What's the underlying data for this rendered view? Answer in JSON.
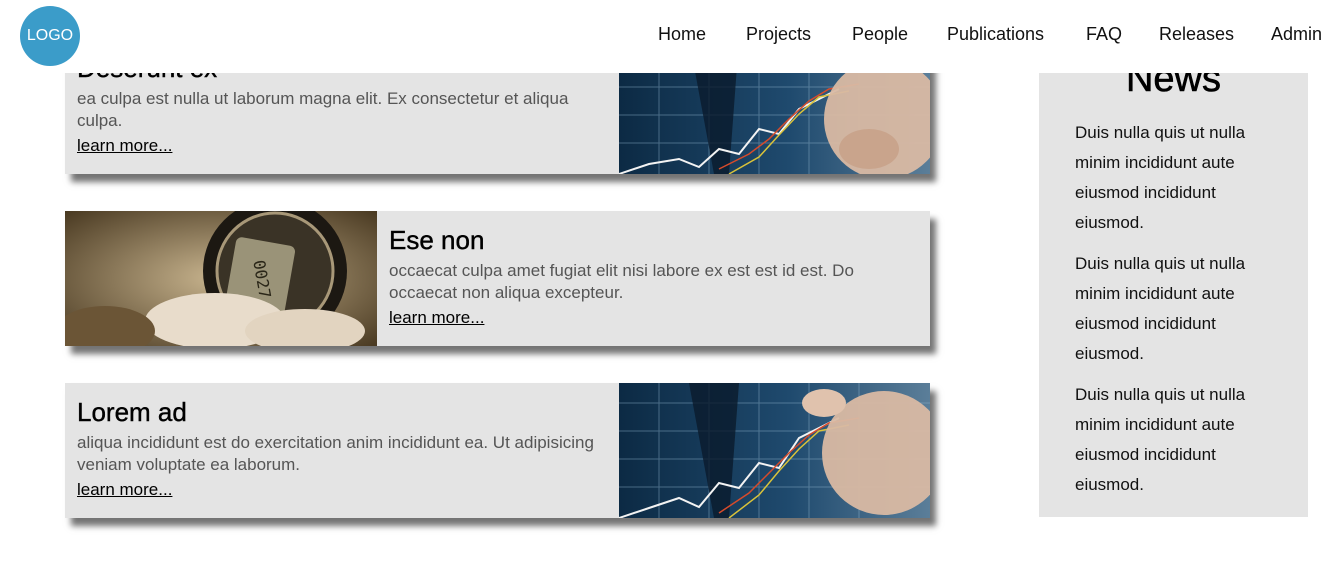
{
  "header": {
    "logo_text": "LOGO",
    "nav": [
      "Home",
      "Projects",
      "People",
      "Publications",
      "FAQ",
      "Releases",
      "Admin"
    ]
  },
  "cards": [
    {
      "title": "Deserunt ex",
      "text": "ea culpa est nulla ut laborum magna elit. Ex consectetur et aliqua culpa.",
      "link": "learn more..."
    },
    {
      "title": "Ese non",
      "text": "occaecat culpa amet fugiat elit nisi labore ex est est id est. Do occaecat non aliqua excepteur.",
      "link": "learn more..."
    },
    {
      "title": "Lorem ad",
      "text": "aliqua incididunt est do exercitation anim incididunt ea. Ut adipisicing veniam voluptate ea laborum.",
      "link": "learn more..."
    }
  ],
  "news": {
    "title": "News",
    "items": [
      "Duis nulla quis ut nulla minim incididunt aute eiusmod incididunt eiusmod.",
      "Duis nulla quis ut nulla minim incididunt aute eiusmod incididunt eiusmod.",
      "Duis nulla quis ut nulla minim incididunt aute eiusmod incididunt eiusmod."
    ]
  },
  "colors": {
    "logo": "#3b9cc9",
    "card_bg": "#e4e4e4"
  }
}
